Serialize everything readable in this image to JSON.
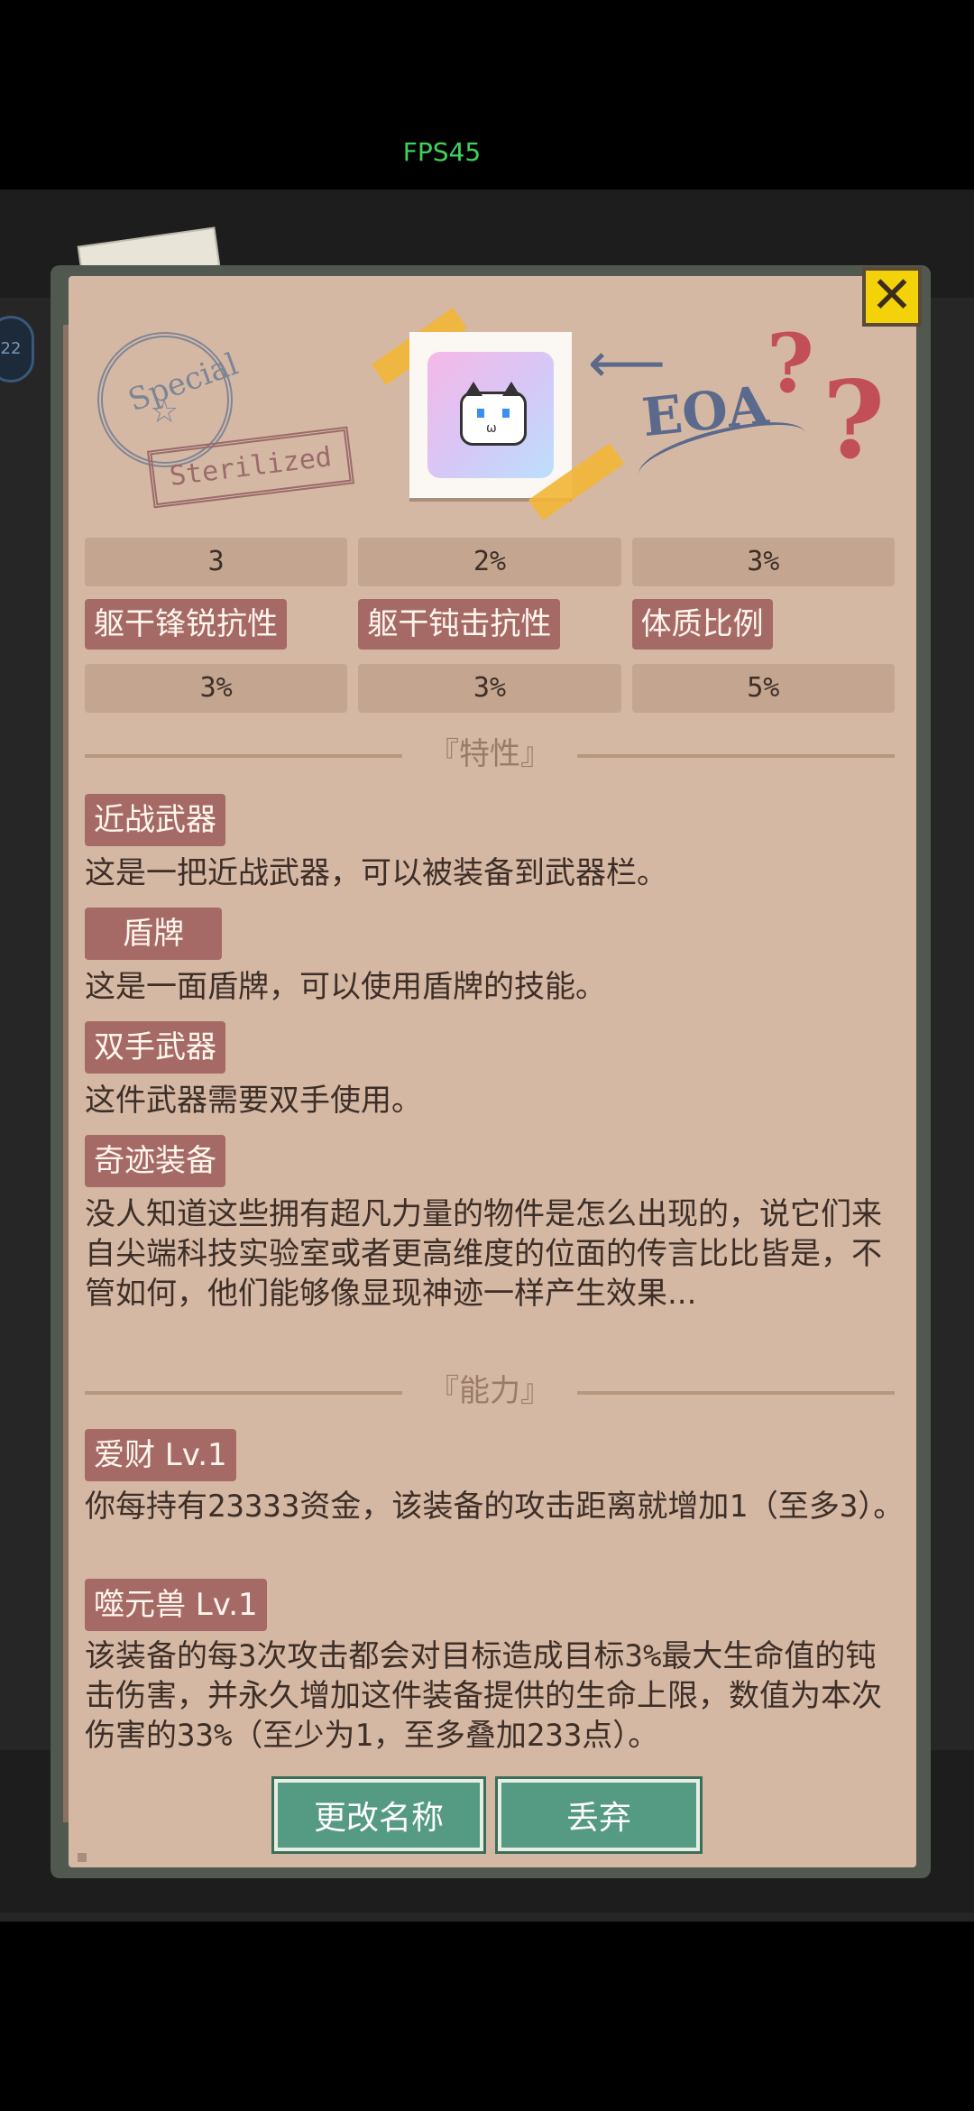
{
  "status": {
    "fps": "FPS45"
  },
  "side_badge": "22",
  "header": {
    "stamp_text": "Special",
    "sterilized": "Sterilized",
    "eoa": "EOA",
    "question_marks": [
      "?",
      "?"
    ]
  },
  "stats_top": [
    "3",
    "2%",
    "3%"
  ],
  "stat_labels": [
    "躯干锋锐抗性",
    "躯干钝击抗性",
    "体质比例"
  ],
  "stats_bottom": [
    "3%",
    "3%",
    "5%"
  ],
  "traits_section": "『特性』",
  "traits": [
    {
      "label": "近战武器",
      "desc": "这是一把近战武器，可以被装备到武器栏。"
    },
    {
      "label": "盾牌",
      "desc": "这是一面盾牌，可以使用盾牌的技能。"
    },
    {
      "label": "双手武器",
      "desc": "这件武器需要双手使用。"
    },
    {
      "label": "奇迹装备",
      "desc": "没人知道这些拥有超凡力量的物件是怎么出现的，说它们来自尖端科技实验室或者更高维度的位面的传言比比皆是，不管如何，他们能够像显现神迹一样产生效果..."
    }
  ],
  "abilities_section": "『能力』",
  "abilities": [
    {
      "label": "爱财 Lv.1",
      "desc": "你每持有23333资金，该装备的攻击距离就增加1（至多3）。"
    },
    {
      "label": "噬元兽 Lv.1",
      "desc": "该装备的每3次攻击都会对目标造成目标3%最大生命值的钝击伤害，并永久增加这件装备提供的生命上限，数值为本次伤害的33%（至少为1，至多叠加233点）。"
    }
  ],
  "buttons": {
    "rename": "更改名称",
    "discard": "丢弃",
    "close": "✕"
  }
}
